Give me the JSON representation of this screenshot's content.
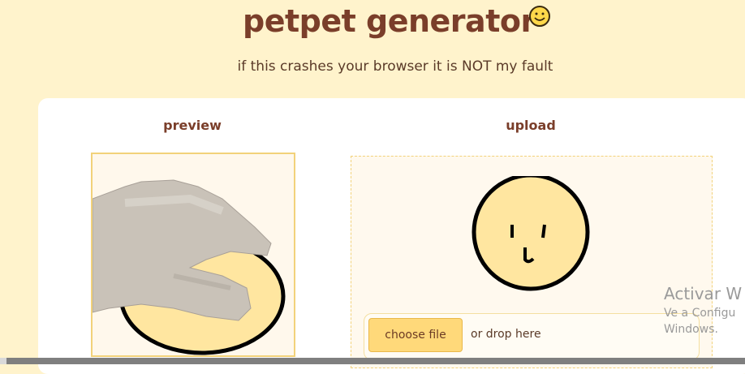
{
  "header": {
    "title": "petpet generator",
    "emoji_icon": "smiley-face-icon",
    "subtitle": "if this crashes your browser it is NOT my fault"
  },
  "preview": {
    "heading": "preview",
    "image_icon": "hand-petting-face-icon"
  },
  "upload": {
    "heading": "upload",
    "image_icon": "smiley-face-drawing-icon",
    "choose_label": "choose file",
    "drop_label": "or drop here"
  },
  "watermark": {
    "line1": "Activar W",
    "line2": "Ve a Configu",
    "line3": "Windows."
  },
  "colors": {
    "background": "#fff3cc",
    "title": "#7a3e2a",
    "accent": "#ffd97a",
    "face": "#ffe6a0"
  }
}
